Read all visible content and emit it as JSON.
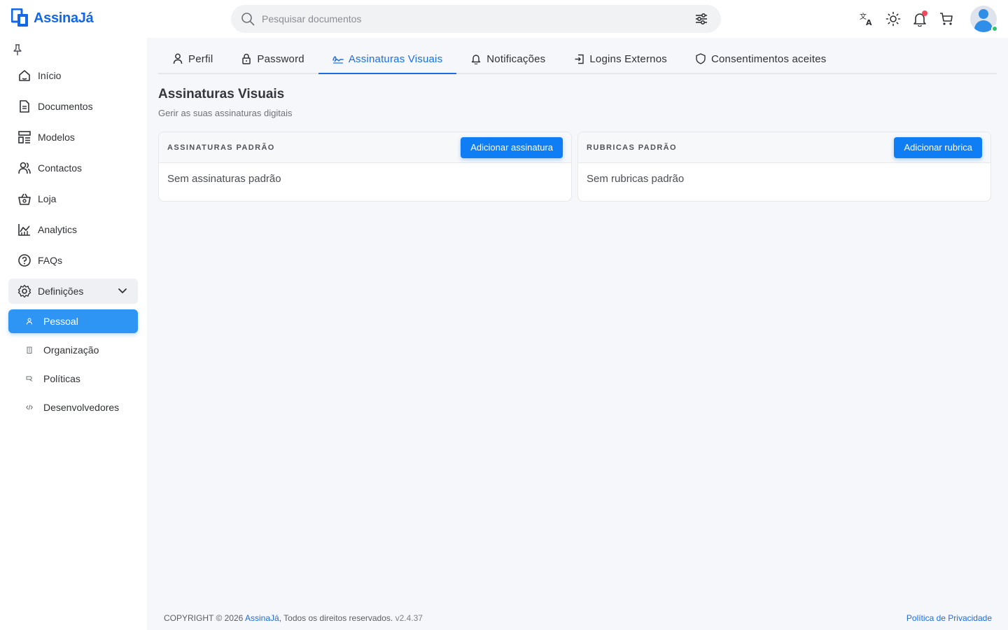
{
  "brand": {
    "name": "AssinaJá",
    "color": "#1467e6"
  },
  "search": {
    "placeholder": "Pesquisar documentos"
  },
  "sidebar": {
    "items": [
      {
        "label": "Início",
        "icon": "home-icon"
      },
      {
        "label": "Documentos",
        "icon": "document-icon"
      },
      {
        "label": "Modelos",
        "icon": "templates-icon"
      },
      {
        "label": "Contactos",
        "icon": "contacts-icon"
      },
      {
        "label": "Loja",
        "icon": "basket-icon"
      },
      {
        "label": "Analytics",
        "icon": "chart-icon"
      },
      {
        "label": "FAQs",
        "icon": "help-icon"
      }
    ],
    "group": {
      "label": "Definições",
      "icon": "gear-icon"
    },
    "sub_items": [
      {
        "label": "Pessoal",
        "icon": "person-icon",
        "active": true
      },
      {
        "label": "Organização",
        "icon": "building-icon"
      },
      {
        "label": "Políticas",
        "icon": "policy-icon"
      },
      {
        "label": "Desenvolvedores",
        "icon": "code-icon"
      }
    ]
  },
  "tabs": [
    {
      "label": "Perfil",
      "icon": "user-icon"
    },
    {
      "label": "Password",
      "icon": "lock-icon"
    },
    {
      "label": "Assinaturas Visuais",
      "icon": "signature-icon",
      "active": true
    },
    {
      "label": "Notificações",
      "icon": "bell-icon"
    },
    {
      "label": "Logins Externos",
      "icon": "login-icon"
    },
    {
      "label": "Consentimentos aceites",
      "icon": "shield-icon"
    }
  ],
  "page": {
    "title": "Assinaturas Visuais",
    "subtitle": "Gerir as suas assinaturas digitais"
  },
  "cards": {
    "signatures": {
      "title": "ASSINATURAS PADRÃO",
      "button": "Adicionar assinatura",
      "empty": "Sem assinaturas padrão"
    },
    "initials": {
      "title": "RUBRICAS PADRÃO",
      "button": "Adicionar rubrica",
      "empty": "Sem rubricas padrão"
    }
  },
  "footer": {
    "prefix": "COPYRIGHT © 2026 ",
    "brand": "AssinaJá",
    "suffix": ", Todos os direitos reservados. ",
    "version": "v2.4.37",
    "privacy": "Política de Privacidade"
  },
  "colors": {
    "accent": "#1a6fe6",
    "active_nav": "#2f95f5",
    "button": "#0f7ef5",
    "notification": "#ef4b5c",
    "online": "#2ec26a"
  }
}
